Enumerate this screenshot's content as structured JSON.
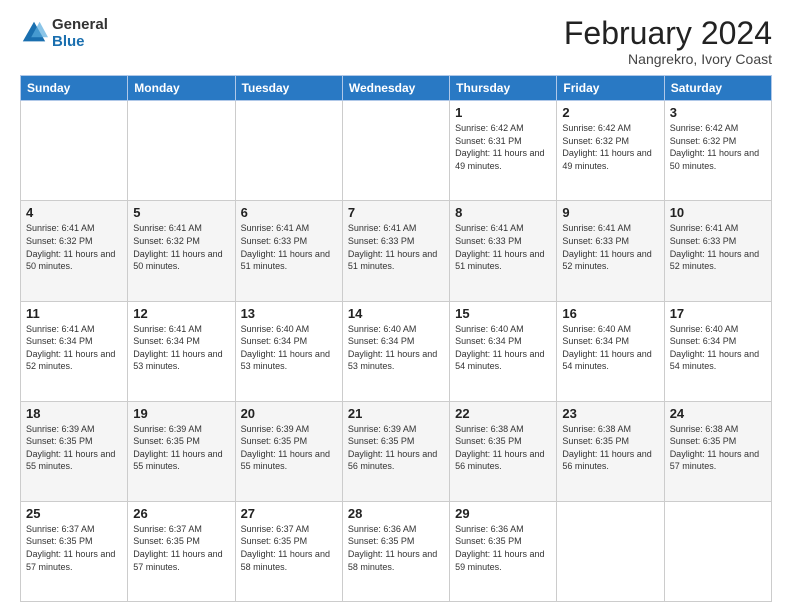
{
  "header": {
    "logo_general": "General",
    "logo_blue": "Blue",
    "month_year": "February 2024",
    "location": "Nangrekro, Ivory Coast"
  },
  "weekdays": [
    "Sunday",
    "Monday",
    "Tuesday",
    "Wednesday",
    "Thursday",
    "Friday",
    "Saturday"
  ],
  "weeks": [
    [
      {
        "day": "",
        "info": ""
      },
      {
        "day": "",
        "info": ""
      },
      {
        "day": "",
        "info": ""
      },
      {
        "day": "",
        "info": ""
      },
      {
        "day": "1",
        "info": "Sunrise: 6:42 AM\nSunset: 6:31 PM\nDaylight: 11 hours and 49 minutes."
      },
      {
        "day": "2",
        "info": "Sunrise: 6:42 AM\nSunset: 6:32 PM\nDaylight: 11 hours and 49 minutes."
      },
      {
        "day": "3",
        "info": "Sunrise: 6:42 AM\nSunset: 6:32 PM\nDaylight: 11 hours and 50 minutes."
      }
    ],
    [
      {
        "day": "4",
        "info": "Sunrise: 6:41 AM\nSunset: 6:32 PM\nDaylight: 11 hours and 50 minutes."
      },
      {
        "day": "5",
        "info": "Sunrise: 6:41 AM\nSunset: 6:32 PM\nDaylight: 11 hours and 50 minutes."
      },
      {
        "day": "6",
        "info": "Sunrise: 6:41 AM\nSunset: 6:33 PM\nDaylight: 11 hours and 51 minutes."
      },
      {
        "day": "7",
        "info": "Sunrise: 6:41 AM\nSunset: 6:33 PM\nDaylight: 11 hours and 51 minutes."
      },
      {
        "day": "8",
        "info": "Sunrise: 6:41 AM\nSunset: 6:33 PM\nDaylight: 11 hours and 51 minutes."
      },
      {
        "day": "9",
        "info": "Sunrise: 6:41 AM\nSunset: 6:33 PM\nDaylight: 11 hours and 52 minutes."
      },
      {
        "day": "10",
        "info": "Sunrise: 6:41 AM\nSunset: 6:33 PM\nDaylight: 11 hours and 52 minutes."
      }
    ],
    [
      {
        "day": "11",
        "info": "Sunrise: 6:41 AM\nSunset: 6:34 PM\nDaylight: 11 hours and 52 minutes."
      },
      {
        "day": "12",
        "info": "Sunrise: 6:41 AM\nSunset: 6:34 PM\nDaylight: 11 hours and 53 minutes."
      },
      {
        "day": "13",
        "info": "Sunrise: 6:40 AM\nSunset: 6:34 PM\nDaylight: 11 hours and 53 minutes."
      },
      {
        "day": "14",
        "info": "Sunrise: 6:40 AM\nSunset: 6:34 PM\nDaylight: 11 hours and 53 minutes."
      },
      {
        "day": "15",
        "info": "Sunrise: 6:40 AM\nSunset: 6:34 PM\nDaylight: 11 hours and 54 minutes."
      },
      {
        "day": "16",
        "info": "Sunrise: 6:40 AM\nSunset: 6:34 PM\nDaylight: 11 hours and 54 minutes."
      },
      {
        "day": "17",
        "info": "Sunrise: 6:40 AM\nSunset: 6:34 PM\nDaylight: 11 hours and 54 minutes."
      }
    ],
    [
      {
        "day": "18",
        "info": "Sunrise: 6:39 AM\nSunset: 6:35 PM\nDaylight: 11 hours and 55 minutes."
      },
      {
        "day": "19",
        "info": "Sunrise: 6:39 AM\nSunset: 6:35 PM\nDaylight: 11 hours and 55 minutes."
      },
      {
        "day": "20",
        "info": "Sunrise: 6:39 AM\nSunset: 6:35 PM\nDaylight: 11 hours and 55 minutes."
      },
      {
        "day": "21",
        "info": "Sunrise: 6:39 AM\nSunset: 6:35 PM\nDaylight: 11 hours and 56 minutes."
      },
      {
        "day": "22",
        "info": "Sunrise: 6:38 AM\nSunset: 6:35 PM\nDaylight: 11 hours and 56 minutes."
      },
      {
        "day": "23",
        "info": "Sunrise: 6:38 AM\nSunset: 6:35 PM\nDaylight: 11 hours and 56 minutes."
      },
      {
        "day": "24",
        "info": "Sunrise: 6:38 AM\nSunset: 6:35 PM\nDaylight: 11 hours and 57 minutes."
      }
    ],
    [
      {
        "day": "25",
        "info": "Sunrise: 6:37 AM\nSunset: 6:35 PM\nDaylight: 11 hours and 57 minutes."
      },
      {
        "day": "26",
        "info": "Sunrise: 6:37 AM\nSunset: 6:35 PM\nDaylight: 11 hours and 57 minutes."
      },
      {
        "day": "27",
        "info": "Sunrise: 6:37 AM\nSunset: 6:35 PM\nDaylight: 11 hours and 58 minutes."
      },
      {
        "day": "28",
        "info": "Sunrise: 6:36 AM\nSunset: 6:35 PM\nDaylight: 11 hours and 58 minutes."
      },
      {
        "day": "29",
        "info": "Sunrise: 6:36 AM\nSunset: 6:35 PM\nDaylight: 11 hours and 59 minutes."
      },
      {
        "day": "",
        "info": ""
      },
      {
        "day": "",
        "info": ""
      }
    ]
  ]
}
